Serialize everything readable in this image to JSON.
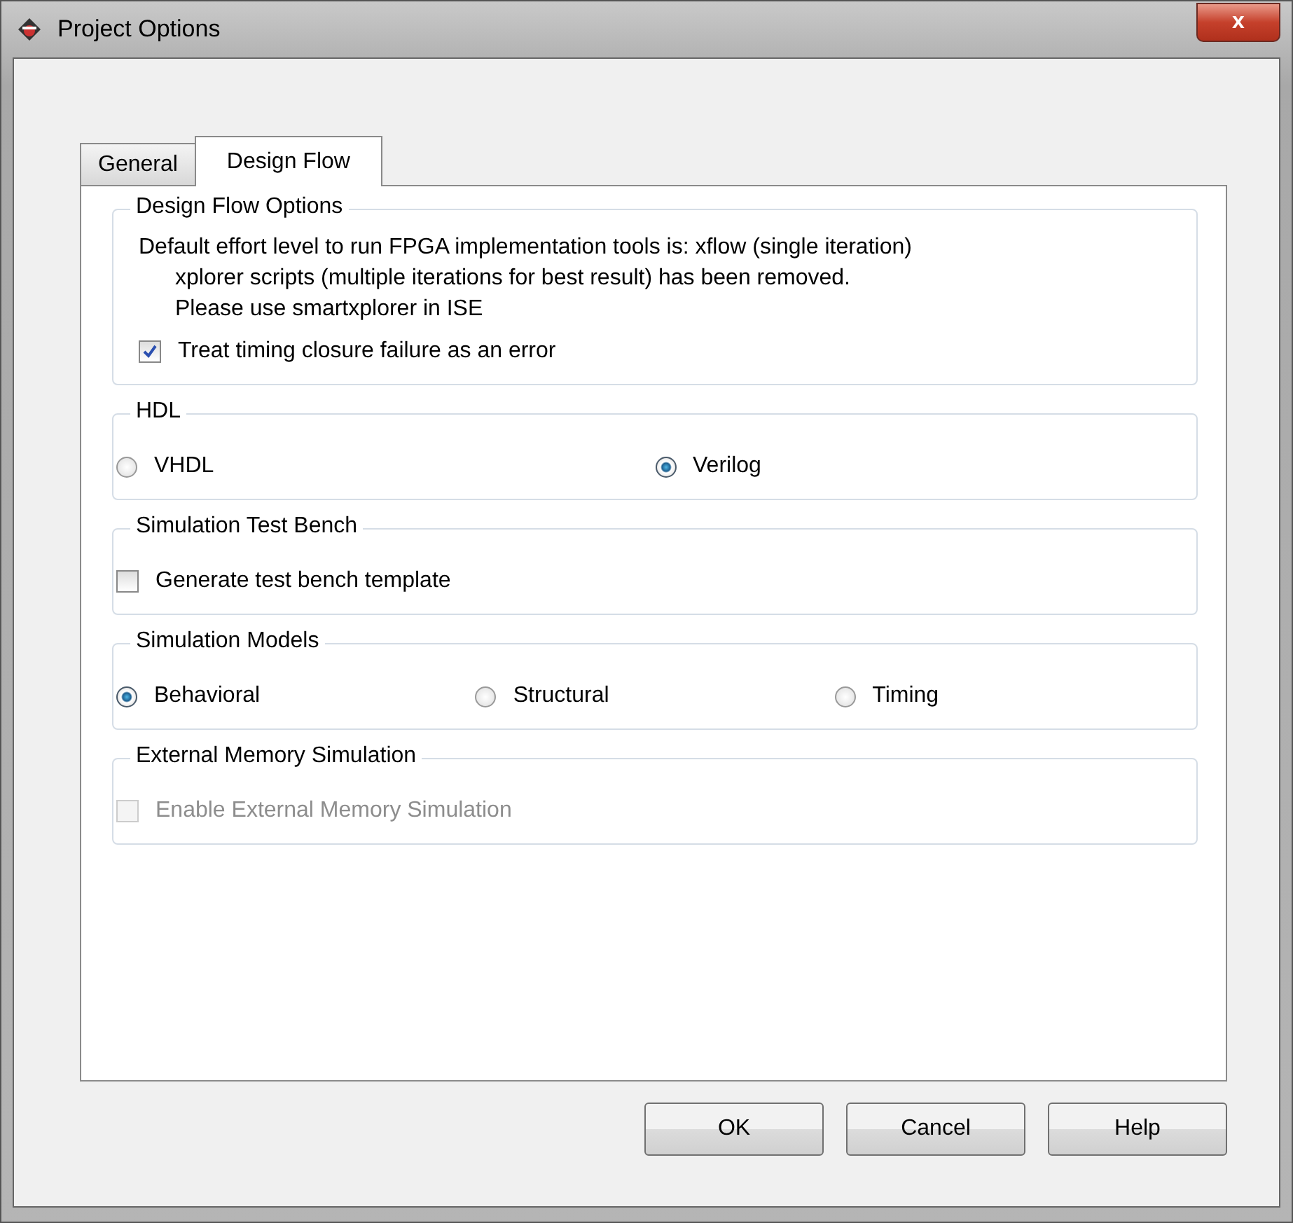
{
  "window": {
    "title": "Project Options",
    "close": "x"
  },
  "tabs": [
    {
      "label": "General",
      "selected": false
    },
    {
      "label": "Design Flow",
      "selected": true
    }
  ],
  "groups": [
    {
      "title": "Design Flow Options",
      "items": [
        {
          "kind": "note",
          "text": "Default effort level to run FPGA implementation tools is: xflow (single iteration)",
          "indented": false
        },
        {
          "kind": "note",
          "text": "xplorer scripts (multiple iterations for best result) has been removed.",
          "indented": true
        },
        {
          "kind": "note",
          "text": "Please use smartxplorer in ISE",
          "indented": true
        },
        {
          "kind": "checkbox",
          "label": "Treat timing closure failure as an error",
          "checked": true,
          "disabled": false
        }
      ]
    },
    {
      "title": "HDL",
      "items": [
        {
          "kind": "radio",
          "label": "VHDL",
          "selected": false
        },
        {
          "kind": "radio",
          "label": "Verilog",
          "selected": true
        }
      ]
    },
    {
      "title": "Simulation Test Bench",
      "items": [
        {
          "kind": "checkbox",
          "label": "Generate test bench template",
          "checked": false,
          "disabled": false
        }
      ]
    },
    {
      "title": "Simulation Models",
      "items": [
        {
          "kind": "radio",
          "label": "Behavioral",
          "selected": true
        },
        {
          "kind": "radio",
          "label": "Structural",
          "selected": false
        },
        {
          "kind": "radio",
          "label": "Timing",
          "selected": false
        }
      ]
    },
    {
      "title": "External Memory Simulation",
      "items": [
        {
          "kind": "checkbox",
          "label": "Enable External Memory Simulation",
          "checked": false,
          "disabled": true
        }
      ]
    }
  ],
  "buttons": [
    "OK",
    "Cancel",
    "Help"
  ]
}
